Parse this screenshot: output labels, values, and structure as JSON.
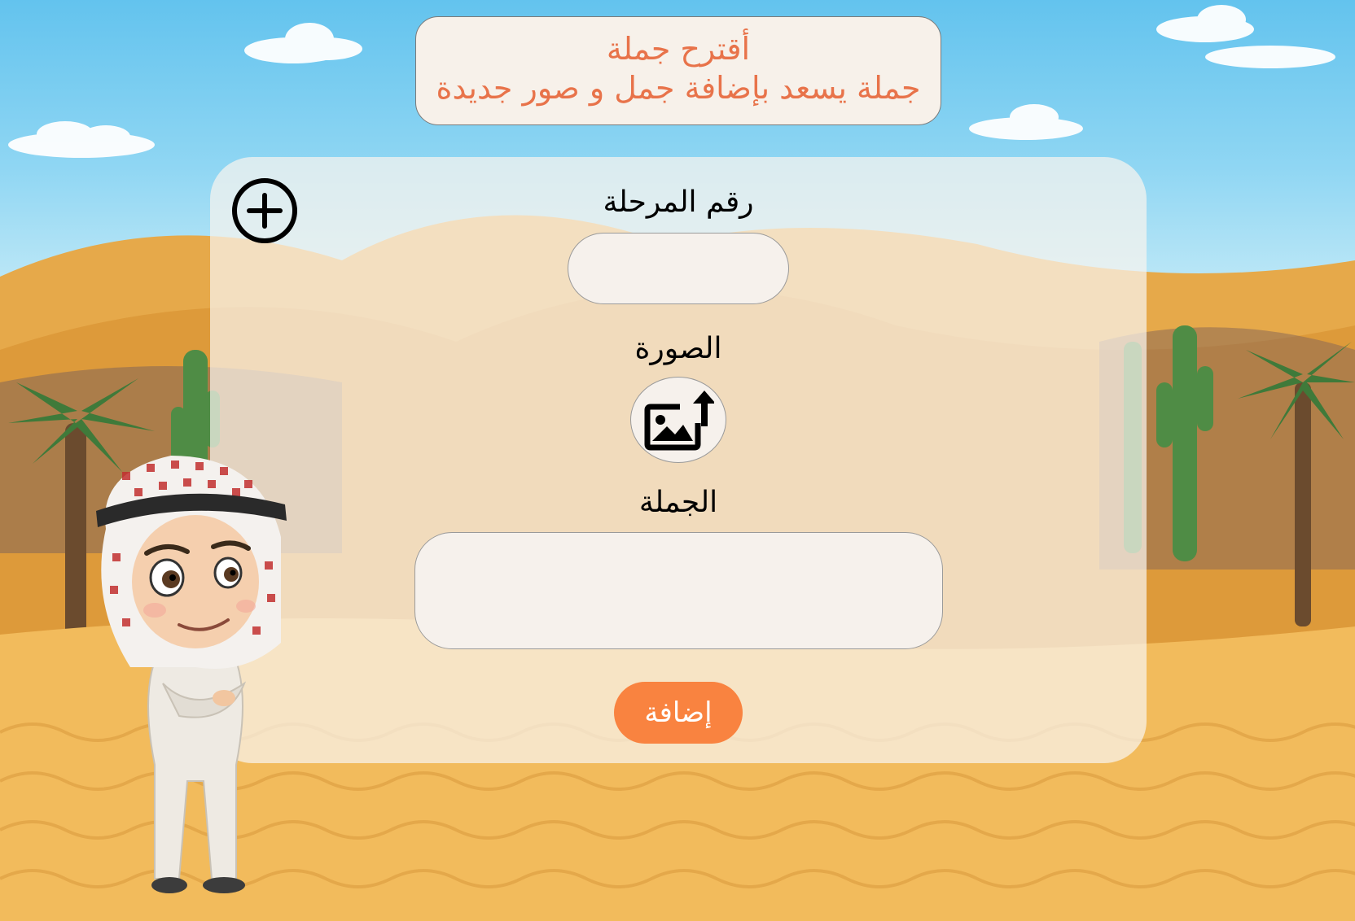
{
  "header": {
    "title": "أقترح جملة",
    "subtitle": "جملة يسعد بإضافة جمل و صور جديدة"
  },
  "form": {
    "stage_label": "رقم المرحلة",
    "stage_value": "",
    "image_label": "الصورة",
    "sentence_label": "الجملة",
    "sentence_value": "",
    "submit_label": "إضافة"
  },
  "icons": {
    "add": "plus-circle-icon",
    "upload": "image-upload-icon"
  },
  "colors": {
    "title_text": "#e8734a",
    "submit_button": "#f98340",
    "panel": "#f8f4ee"
  }
}
